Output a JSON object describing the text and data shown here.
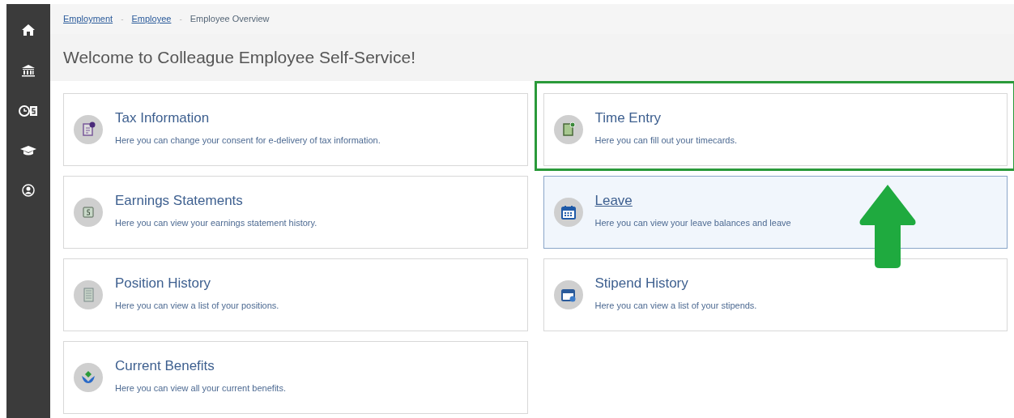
{
  "sidebar": {
    "items": [
      {
        "selected": false
      },
      {
        "selected": false
      },
      {
        "selected": false
      },
      {
        "selected": false
      },
      {
        "selected": false
      }
    ]
  },
  "breadcrumb_separator": "-",
  "breadcrumb": [
    {
      "label": "Employment",
      "link": true
    },
    {
      "label": "Employee",
      "link": true
    },
    {
      "label": "Employee Overview",
      "link": false
    }
  ],
  "page_title": "Welcome to Colleague Employee Self-Service!",
  "cards": [
    {
      "title": "Tax Information",
      "description": "Here you can change your consent for e-delivery of tax information.",
      "hovered": false,
      "highlighted": false
    },
    {
      "title": "Time Entry",
      "description": "Here you can fill out your timecards.",
      "hovered": false,
      "highlighted": true
    },
    {
      "title": "Earnings Statements",
      "description": "Here you can view your earnings statement history.",
      "hovered": false,
      "highlighted": false
    },
    {
      "title": "Leave",
      "description": "Here you can view your leave balances and leave",
      "hovered": true,
      "highlighted": false
    },
    {
      "title": "Position History",
      "description": "Here you can view a list of your positions.",
      "hovered": false,
      "highlighted": false
    },
    {
      "title": "Stipend History",
      "description": "Here you can view a list of your stipends.",
      "hovered": false,
      "highlighted": false
    },
    {
      "title": "Current Benefits",
      "description": "Here you can view all your current benefits.",
      "hovered": false,
      "highlighted": false
    }
  ]
}
